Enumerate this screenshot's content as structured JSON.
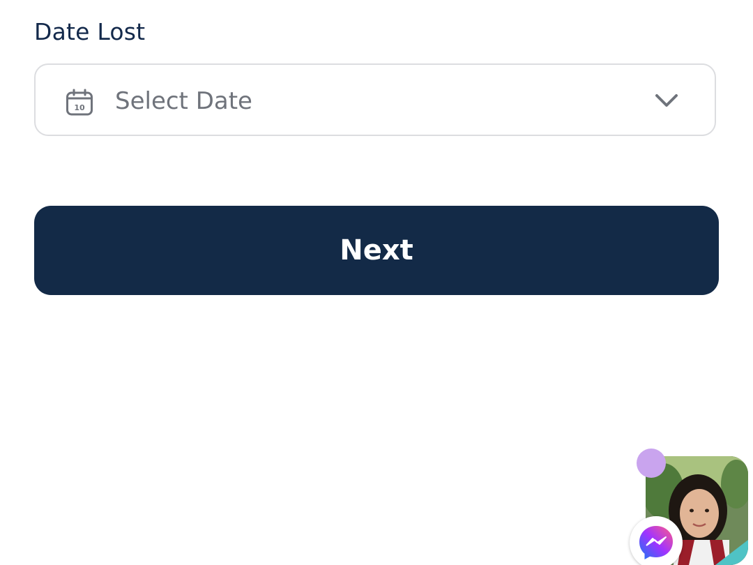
{
  "form": {
    "date_label": "Date Lost",
    "date_placeholder": "Select Date",
    "calendar_day": "10",
    "next_label": "Next"
  },
  "colors": {
    "primary": "#132a47",
    "label_text": "#13294b",
    "placeholder_text": "#6f737b",
    "border": "#dcdde0",
    "notification_dot": "#c9a4ee"
  },
  "icons": {
    "calendar": "calendar-icon",
    "dropdown": "chevron-down-icon",
    "chat_head": "messenger-icon"
  }
}
